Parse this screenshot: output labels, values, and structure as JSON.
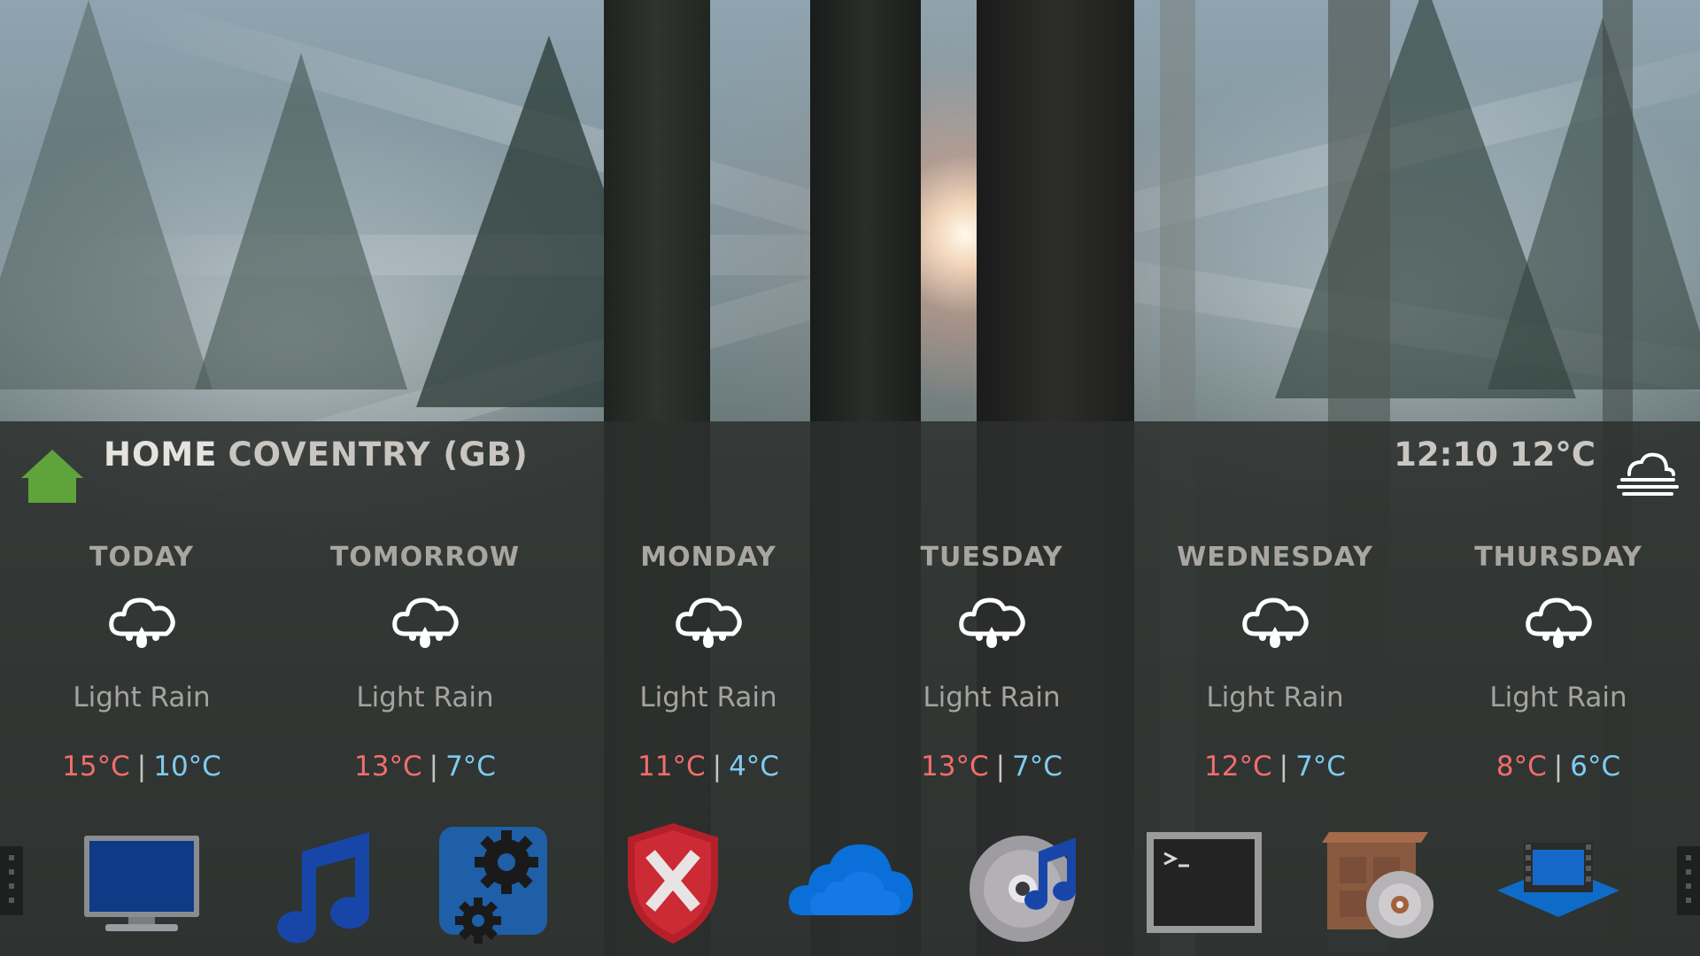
{
  "location": {
    "home_label": "HOME",
    "city": "COVENTRY (GB)"
  },
  "current": {
    "time": "12:10",
    "temp": "12°C",
    "icon": "fog-icon"
  },
  "forecast": [
    {
      "day": "TODAY",
      "icon": "light-rain-icon",
      "desc": "Light Rain",
      "high": "15°C",
      "low": "10°C"
    },
    {
      "day": "TOMORROW",
      "icon": "light-rain-icon",
      "desc": "Light Rain",
      "high": "13°C",
      "low": "7°C"
    },
    {
      "day": "MONDAY",
      "icon": "light-rain-icon",
      "desc": "Light Rain",
      "high": "11°C",
      "low": "4°C"
    },
    {
      "day": "TUESDAY",
      "icon": "light-rain-icon",
      "desc": "Light Rain",
      "high": "13°C",
      "low": "7°C"
    },
    {
      "day": "WEDNESDAY",
      "icon": "light-rain-icon",
      "desc": "Light Rain",
      "high": "12°C",
      "low": "7°C"
    },
    {
      "day": "THURSDAY",
      "icon": "light-rain-icon",
      "desc": "Light Rain",
      "high": "8°C",
      "low": "6°C"
    }
  ],
  "temp_separator": "|",
  "dock": [
    {
      "icon": "monitor-icon"
    },
    {
      "icon": "music-note-icon"
    },
    {
      "icon": "system-settings-icon"
    },
    {
      "icon": "security-shield-icon"
    },
    {
      "icon": "cloud-storage-icon"
    },
    {
      "icon": "music-disc-icon"
    },
    {
      "icon": "terminal-icon"
    },
    {
      "icon": "package-installer-icon"
    },
    {
      "icon": "video-player-icon"
    }
  ],
  "colors": {
    "home_icon": "#5fa33d",
    "high_temp": "#f26d6d",
    "low_temp": "#7fcbf1",
    "panel": "#2c302d"
  }
}
